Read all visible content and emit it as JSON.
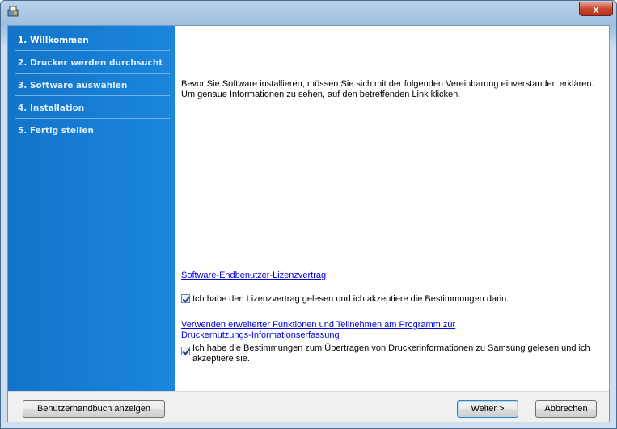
{
  "window": {
    "close_glyph": "x"
  },
  "sidebar": {
    "steps": [
      {
        "label": "1. Willkommen"
      },
      {
        "label": "2. Drucker werden durchsucht"
      },
      {
        "label": "3. Software auswählen"
      },
      {
        "label": "4. Installation"
      },
      {
        "label": "5. Fertig stellen"
      }
    ],
    "active_step": 0
  },
  "main": {
    "intro": "Bevor Sie Software installieren, müssen Sie sich mit der folgenden Vereinbarung einverstanden erklären. Um genaue Informationen zu sehen, auf den betreffenden Link klicken.",
    "license_link": "Software-Endbenutzer-Lizenzvertrag",
    "license_check": {
      "label": "Ich habe den Lizenzvertrag gelesen und ich akzeptiere die Bestimmungen darin.",
      "checked": true
    },
    "program_link": "Verwenden erweiterter Funktionen und Teilnehmen am Programm zur Druckernutzungs-Informationserfassung",
    "program_check": {
      "label": "Ich habe die Bestimmungen zum Übertragen von Druckerinformationen zu Samsung gelesen und ich akzeptiere sie.",
      "checked": true
    }
  },
  "footer": {
    "manual_button": "Benutzerhandbuch anzeigen",
    "next_button": "Weiter >",
    "cancel_button": "Abbrechen"
  },
  "colors": {
    "sidebar": "#1a7fd4",
    "link": "#0000e0",
    "close_button": "#c8462e"
  }
}
